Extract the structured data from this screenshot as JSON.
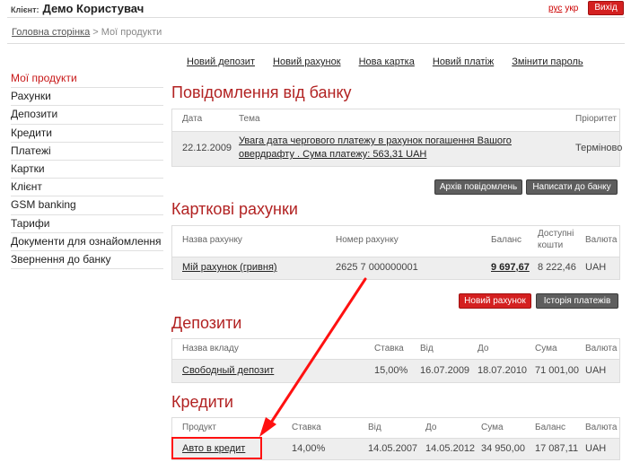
{
  "header": {
    "client_label": "Клієнт:",
    "client_name": "Демо Користувач",
    "lang_ru": "рус",
    "lang_ua": "укр",
    "exit_label": "Вихід"
  },
  "breadcrumb": {
    "home": "Головна сторінка",
    "sep": ">",
    "current": "Мої продукти"
  },
  "sidebar": {
    "items": [
      {
        "label": "Мої продукти"
      },
      {
        "label": "Рахунки"
      },
      {
        "label": "Депозити"
      },
      {
        "label": "Кредити"
      },
      {
        "label": "Платежі"
      },
      {
        "label": "Картки"
      },
      {
        "label": "Клієнт"
      },
      {
        "label": "GSM banking"
      },
      {
        "label": "Тарифи"
      },
      {
        "label": "Документи для ознайомлення"
      },
      {
        "label": "Звернення до банку"
      }
    ]
  },
  "topnav": {
    "items": [
      {
        "label": "Новий депозит"
      },
      {
        "label": "Новий рахунок"
      },
      {
        "label": "Нова картка"
      },
      {
        "label": "Новий платіж"
      },
      {
        "label": "Змінити пароль"
      }
    ]
  },
  "messages": {
    "title": "Повідомлення від банку",
    "columns": {
      "date": "Дата",
      "subject": "Тема",
      "priority": "Пріоритет"
    },
    "rows": [
      {
        "date": "22.12.2009",
        "subject_line1": "Увага дата чергового платежу в рахунок погашення Вашого",
        "subject_line2": "овердрафту . Сума платежу: 563,31 UAH",
        "priority": "Терміново"
      }
    ],
    "archive_button": "Архів повідомлень",
    "write_button": "Написати до банку"
  },
  "card_accounts": {
    "title": "Карткові рахунки",
    "columns": {
      "name": "Назва рахунку",
      "number": "Номер рахунку",
      "balance": "Баланс",
      "available_1": "Доступні",
      "available_2": "кошти",
      "currency": "Валюта"
    },
    "rows": [
      {
        "name": "Мій рахунок (гривня)",
        "number": "2625 7 000000001",
        "balance": "9 697,67",
        "available": "8 222,46",
        "currency": "UAH"
      }
    ],
    "new_account_button": "Новий рахунок",
    "history_button": "Історія платежів"
  },
  "deposits": {
    "title": "Депозити",
    "columns": {
      "name": "Назва вкладу",
      "rate": "Ставка",
      "from": "Від",
      "to": "До",
      "amount": "Сума",
      "currency": "Валюта"
    },
    "rows": [
      {
        "name": "Свободный депозит",
        "rate": "15,00%",
        "from": "16.07.2009",
        "to": "18.07.2010",
        "amount": "71 001,00",
        "currency": "UAH"
      }
    ]
  },
  "credits": {
    "title": "Кредити",
    "columns": {
      "product": "Продукт",
      "rate": "Ставка",
      "from": "Від",
      "to": "До",
      "amount": "Сума",
      "balance": "Баланс",
      "currency": "Валюта"
    },
    "rows": [
      {
        "product": "Авто в кредит",
        "rate": "14,00%",
        "from": "14.05.2007",
        "to": "14.05.2012",
        "amount": "34 950,00",
        "balance": "17 087,11",
        "currency": "UAH"
      }
    ]
  },
  "colors": {
    "accent": "#b22222",
    "button_red": "#d42020",
    "button_dark": "#5e5e5e",
    "annotation": "#ff1111"
  }
}
